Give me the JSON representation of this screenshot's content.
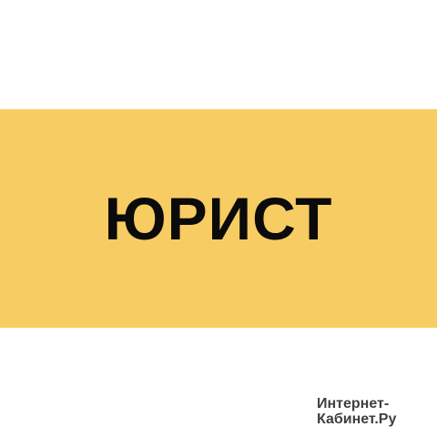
{
  "colors": {
    "page_background": "#ffffff",
    "banner_background": "#f7cc62",
    "title_text": "#0b0b0b",
    "watermark_text": "#3f3f3f"
  },
  "banner": {
    "title": "ЮРИСТ"
  },
  "watermark": {
    "line1": "Интернет-",
    "line2": "Кабинет.Ру"
  }
}
